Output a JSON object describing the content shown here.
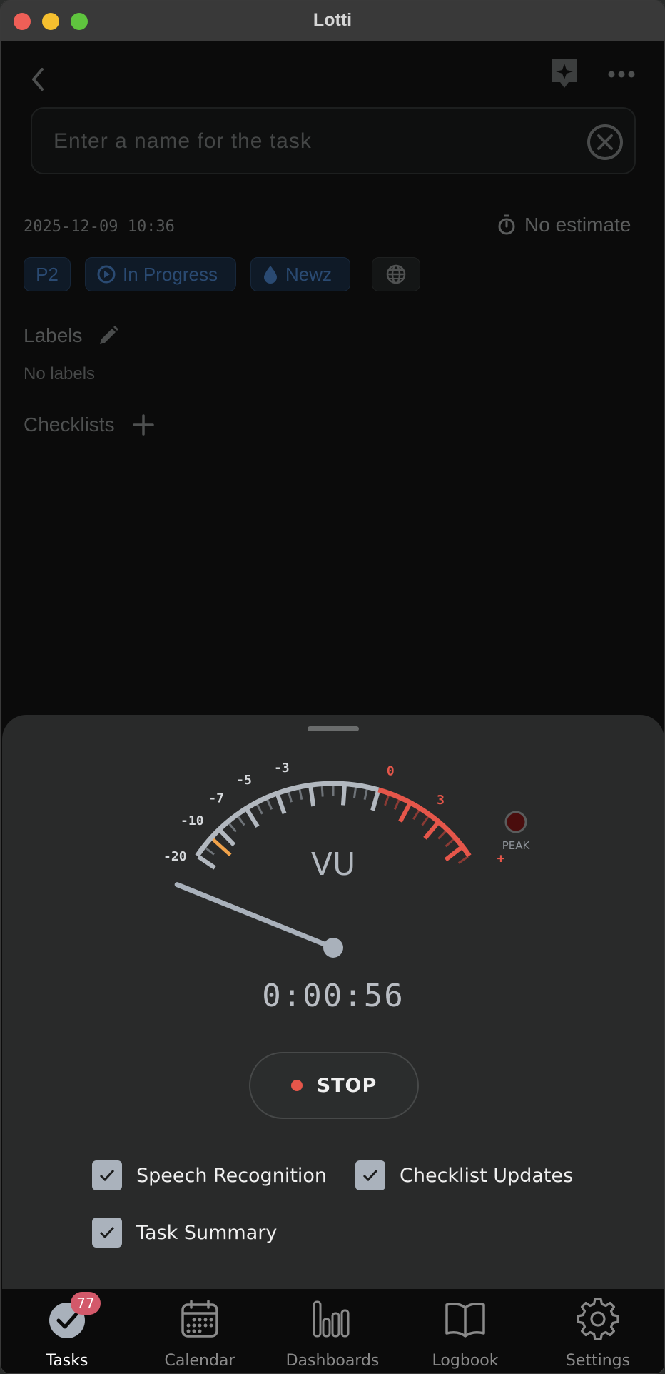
{
  "window": {
    "title": "Lotti"
  },
  "task": {
    "name_placeholder": "Enter a name for the task",
    "name_value": "",
    "date": "2025-12-09 10:36",
    "estimate": "No estimate",
    "priority": "P2",
    "status": "In Progress",
    "category": "Newz",
    "labels_heading": "Labels",
    "labels_empty": "No labels",
    "checklists_heading": "Checklists"
  },
  "recorder": {
    "meter_title": "VU",
    "peak_label": "PEAK",
    "scale_labels": [
      "-20",
      "-10",
      "-7",
      "-5",
      "-3",
      "0",
      "3",
      "+"
    ],
    "level_db": -20,
    "timer": "0:00:56",
    "stop_label": "STOP",
    "options": [
      {
        "label": "Speech Recognition",
        "checked": true
      },
      {
        "label": "Checklist Updates",
        "checked": true
      },
      {
        "label": "Task Summary",
        "checked": true
      }
    ]
  },
  "colors": {
    "accent_red": "#e5564a",
    "meter_grey": "#b2b8bf",
    "meter_orange": "#f0a24a",
    "chip_blue": "#2a4a72",
    "badge": "#d3596a"
  },
  "nav": {
    "items": [
      {
        "label": "Tasks",
        "icon": "tasks-check-icon",
        "active": true,
        "badge": "77"
      },
      {
        "label": "Calendar",
        "icon": "calendar-icon",
        "active": false
      },
      {
        "label": "Dashboards",
        "icon": "bar-chart-icon",
        "active": false
      },
      {
        "label": "Logbook",
        "icon": "book-icon",
        "active": false
      },
      {
        "label": "Settings",
        "icon": "gear-icon",
        "active": false
      }
    ]
  }
}
